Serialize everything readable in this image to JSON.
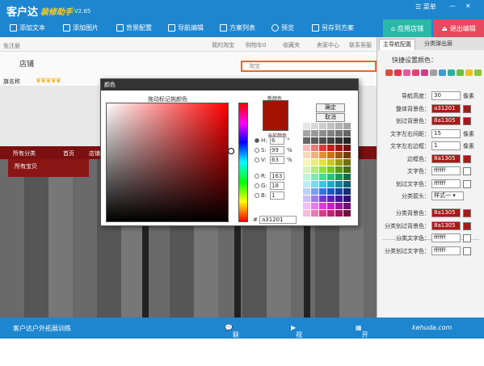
{
  "app": {
    "logo": "客户达",
    "subtitle": "装修助手",
    "version": "V2.65",
    "menu": "菜单"
  },
  "toolbar": {
    "items": [
      "添加文本",
      "添加图片",
      "背景配置",
      "导航编辑",
      "方案列表",
      "预览",
      "另存到方案"
    ],
    "apply": "应用店铺",
    "exit": "退出编辑"
  },
  "canvas": {
    "topnav": [
      "我的淘宝",
      "购物车0",
      "收藏夹",
      "卖家中心",
      "联系客服"
    ],
    "register": "免注册",
    "store": "店铺",
    "search_placeholder": "淘宝",
    "rating_label": "旗名称",
    "nav": [
      "所有分类",
      "首页",
      "店铺"
    ],
    "submenu": "所有宝贝"
  },
  "panel": {
    "tabs": [
      "主导航配置",
      "分类弹出层"
    ],
    "quick_title": "快捷设置颜色：",
    "swatch_colors": [
      "#e24a3b",
      "#e8324d",
      "#e85aa0",
      "#e84070",
      "#d83a8a",
      "#a0a0a0",
      "#3b9ad8",
      "#2cb0a0",
      "#68c23a",
      "#f0c020",
      "#8cc63a"
    ],
    "rows": [
      {
        "label": "导航高度：",
        "value": "30",
        "unit": "像素"
      },
      {
        "label": "整体背景色：",
        "value": "a31201",
        "chip": "red"
      },
      {
        "label": "划过背景色：",
        "value": "8a1305",
        "chip": "red"
      },
      {
        "label": "文字左右间距：",
        "value": "15",
        "unit": "像素"
      },
      {
        "label": "文字左右边框：",
        "value": "1",
        "unit": "像素"
      },
      {
        "label": "边框色：",
        "value": "8a1305",
        "chip": "red"
      },
      {
        "label": "文字色：",
        "value": "ffffff",
        "chip": "white"
      },
      {
        "label": "划过文字色：",
        "value": "ffffff",
        "chip": "white"
      },
      {
        "label": "分类箭头：",
        "select": "样式一"
      }
    ],
    "rows2": [
      {
        "label": "分类背景色：",
        "value": "8a1305",
        "chip": "red"
      },
      {
        "label": "分类划过背景色：",
        "value": "8a1305",
        "chip": "red"
      },
      {
        "label": "分类文字色：",
        "value": "ffffff",
        "chip": "white"
      },
      {
        "label": "分类划过文字色：",
        "value": "ffffff",
        "chip": "white"
      }
    ]
  },
  "dialog": {
    "title": "颜色",
    "subtitle": "拖动标记挑颜色",
    "new_label": "新颜色",
    "current_label": "当前颜色",
    "ok": "确定",
    "cancel": "取消",
    "fields": [
      {
        "key": "H:",
        "value": "6",
        "unit": "°",
        "selected": true
      },
      {
        "key": "S:",
        "value": "99",
        "unit": "%"
      },
      {
        "key": "V:",
        "value": "63",
        "unit": "%"
      },
      {
        "key": "R:",
        "value": "163"
      },
      {
        "key": "G:",
        "value": "18"
      },
      {
        "key": "B:",
        "value": "1"
      }
    ],
    "hex_label": "#",
    "hex": "a31201"
  },
  "status": {
    "left": "客户达户外拓展训练",
    "service": "联系客服",
    "tutorial": "视频教程",
    "open": "开店助手",
    "brand": "kehuda.com"
  }
}
